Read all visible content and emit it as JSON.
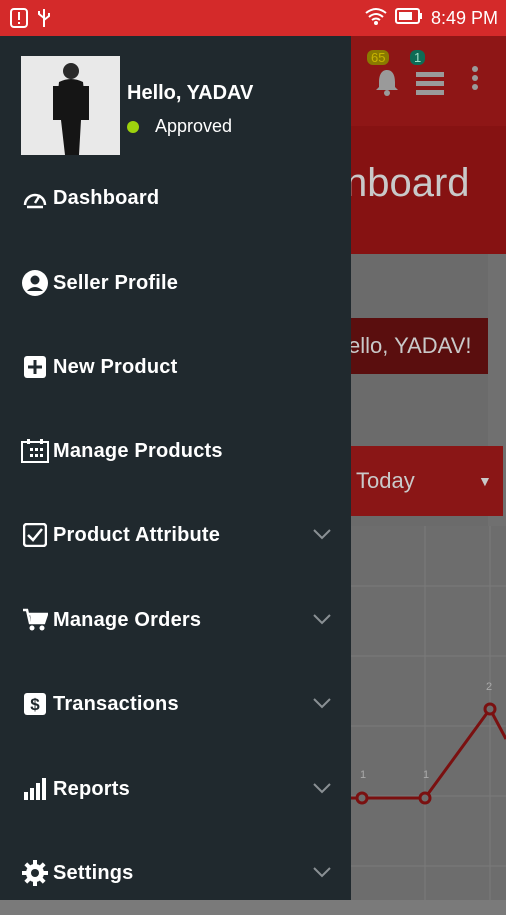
{
  "status_bar": {
    "time": "8:49 PM",
    "icons": [
      "alert-icon",
      "usb-icon",
      "wifi-icon",
      "battery-icon"
    ]
  },
  "background_app": {
    "page_title": "nboard",
    "greeting": "ello, YADAV!",
    "filter_value": "Today",
    "notification_count": "65",
    "cart_count": "1",
    "chart_labels": [
      "1",
      "1",
      "2"
    ]
  },
  "drawer": {
    "user": {
      "greeting": "Hello, YADAV",
      "status": "Approved",
      "status_color": "#9dd20d"
    },
    "menu": [
      {
        "label": "Dashboard",
        "icon": "speedometer-icon",
        "expandable": false
      },
      {
        "label": "Seller Profile",
        "icon": "account-circle-icon",
        "expandable": false
      },
      {
        "label": "New Product",
        "icon": "add-box-icon",
        "expandable": false
      },
      {
        "label": "Manage Products",
        "icon": "calendar-grid-icon",
        "expandable": false
      },
      {
        "label": "Product Attribute",
        "icon": "check-box-icon",
        "expandable": true
      },
      {
        "label": "Manage Orders",
        "icon": "cart-icon",
        "expandable": true
      },
      {
        "label": "Transactions",
        "icon": "dollar-icon",
        "expandable": true
      },
      {
        "label": "Reports",
        "icon": "signal-bars-icon",
        "expandable": true
      },
      {
        "label": "Settings",
        "icon": "gear-icon",
        "expandable": true
      }
    ]
  },
  "colors": {
    "status_bar": "#d42a2a",
    "drawer_bg": "#20292e",
    "accent_red": "#8a1616"
  }
}
